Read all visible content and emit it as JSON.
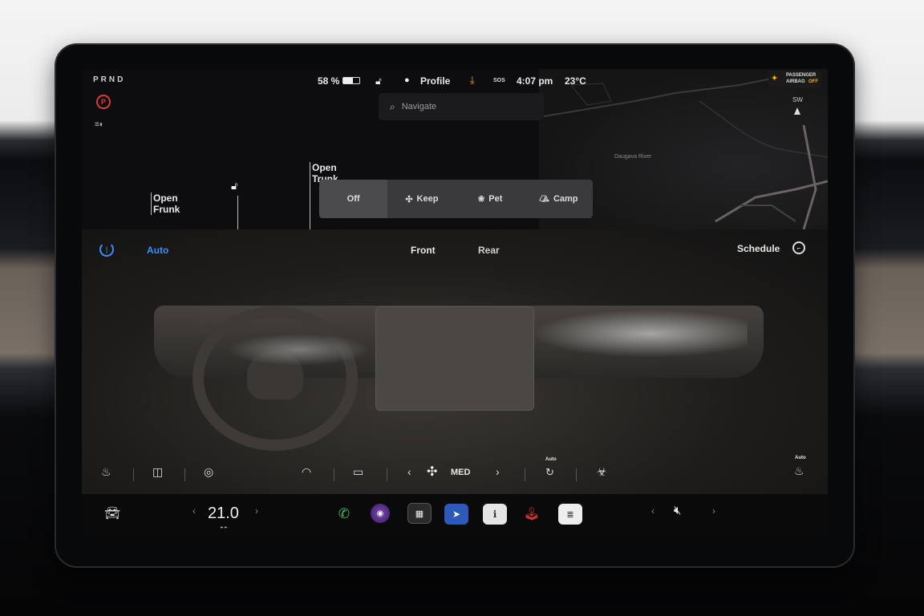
{
  "status_bar": {
    "gear": "PRND",
    "battery": "58 %",
    "profile": "Profile",
    "sos": "SOS",
    "time": "4:07 pm",
    "temperature": "23°C",
    "airbag_line1": "PASSENGER",
    "airbag_line2": "AIRBAG",
    "airbag_state": "OFF"
  },
  "map": {
    "search_placeholder": "Navigate",
    "compass": "SW",
    "place_label": "Daugava River"
  },
  "vehicle": {
    "frunk_line1": "Open",
    "frunk_line2": "Frunk",
    "trunk_line1": "Open",
    "trunk_line2": "Trunk"
  },
  "climate_modes": [
    {
      "label": "Off",
      "icon": "none"
    },
    {
      "label": "Keep",
      "icon": "fan-icon"
    },
    {
      "label": "Pet",
      "icon": "paw-icon"
    },
    {
      "label": "Camp",
      "icon": "tent-icon"
    }
  ],
  "climate_bar": {
    "auto": "Auto",
    "front": "Front",
    "rear": "Rear",
    "schedule": "Schedule"
  },
  "fan": {
    "speed": "MED",
    "recirc_label": "Auto",
    "seat_label": "Auto"
  },
  "dock": {
    "temperature": "21.0"
  },
  "colors": {
    "accent": "#3b8cff",
    "park": "#e03a2f",
    "download": "#f0a020",
    "airbag": "#f5b400",
    "phone": "#3cc35a"
  }
}
